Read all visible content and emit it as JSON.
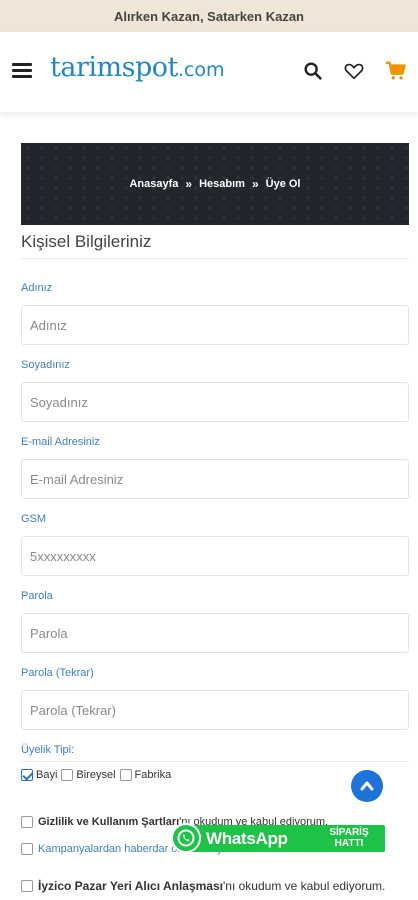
{
  "topbar": {
    "slogan": "Alırken Kazan, Satarken Kazan"
  },
  "header": {
    "logo_main": "tarimspot",
    "logo_suffix": ".com",
    "icons": [
      "menu-icon",
      "search-icon",
      "heart-icon",
      "cart-icon"
    ],
    "cart_color": "#f39200"
  },
  "breadcrumb": {
    "items": [
      "Anasayfa",
      "Hesabım",
      "Üye Ol"
    ],
    "separator": "»"
  },
  "section": {
    "title": "Kişisel Bilgileriniz"
  },
  "form": {
    "fields": [
      {
        "label": "Adınız",
        "placeholder": "Adınız",
        "value": ""
      },
      {
        "label": "Soyadınız",
        "placeholder": "Soyadınız",
        "value": ""
      },
      {
        "label": "E-mail Adresiniz",
        "placeholder": "E-mail Adresiniz",
        "value": ""
      },
      {
        "label": "GSM",
        "placeholder": "5xxxxxxxxx",
        "value": ""
      },
      {
        "label": "Parola",
        "placeholder": "Parola",
        "value": ""
      },
      {
        "label": "Parola (Tekrar)",
        "placeholder": "Parola (Tekrar)",
        "value": ""
      }
    ],
    "membership_label": "Üyelik Tipi:",
    "membership_options": [
      {
        "label": "Bayi",
        "checked": true
      },
      {
        "label": "Bireysel",
        "checked": false
      },
      {
        "label": "Fabrika",
        "checked": false
      }
    ],
    "agreements": [
      {
        "bold": "Gizlilik ve Kullanım Şartları",
        "rest": "'nı okudum ve kabul ediyorum."
      },
      {
        "bold": "",
        "rest": "Kampanyalardan haberdar olmak istiyorum."
      },
      {
        "bold": "İyzico Pazar Yeri Alıcı Anlaşması",
        "rest": "'nı okudum ve kabul ediyorum."
      }
    ]
  },
  "whatsapp": {
    "title": "WhatsApp",
    "subtitle_line1": "SİPARİŞ",
    "subtitle_line2": "HATTI"
  },
  "colors": {
    "accent": "#3f7ec6",
    "whatsapp": "#1ec247",
    "scroll_button": "#1e73d9"
  }
}
